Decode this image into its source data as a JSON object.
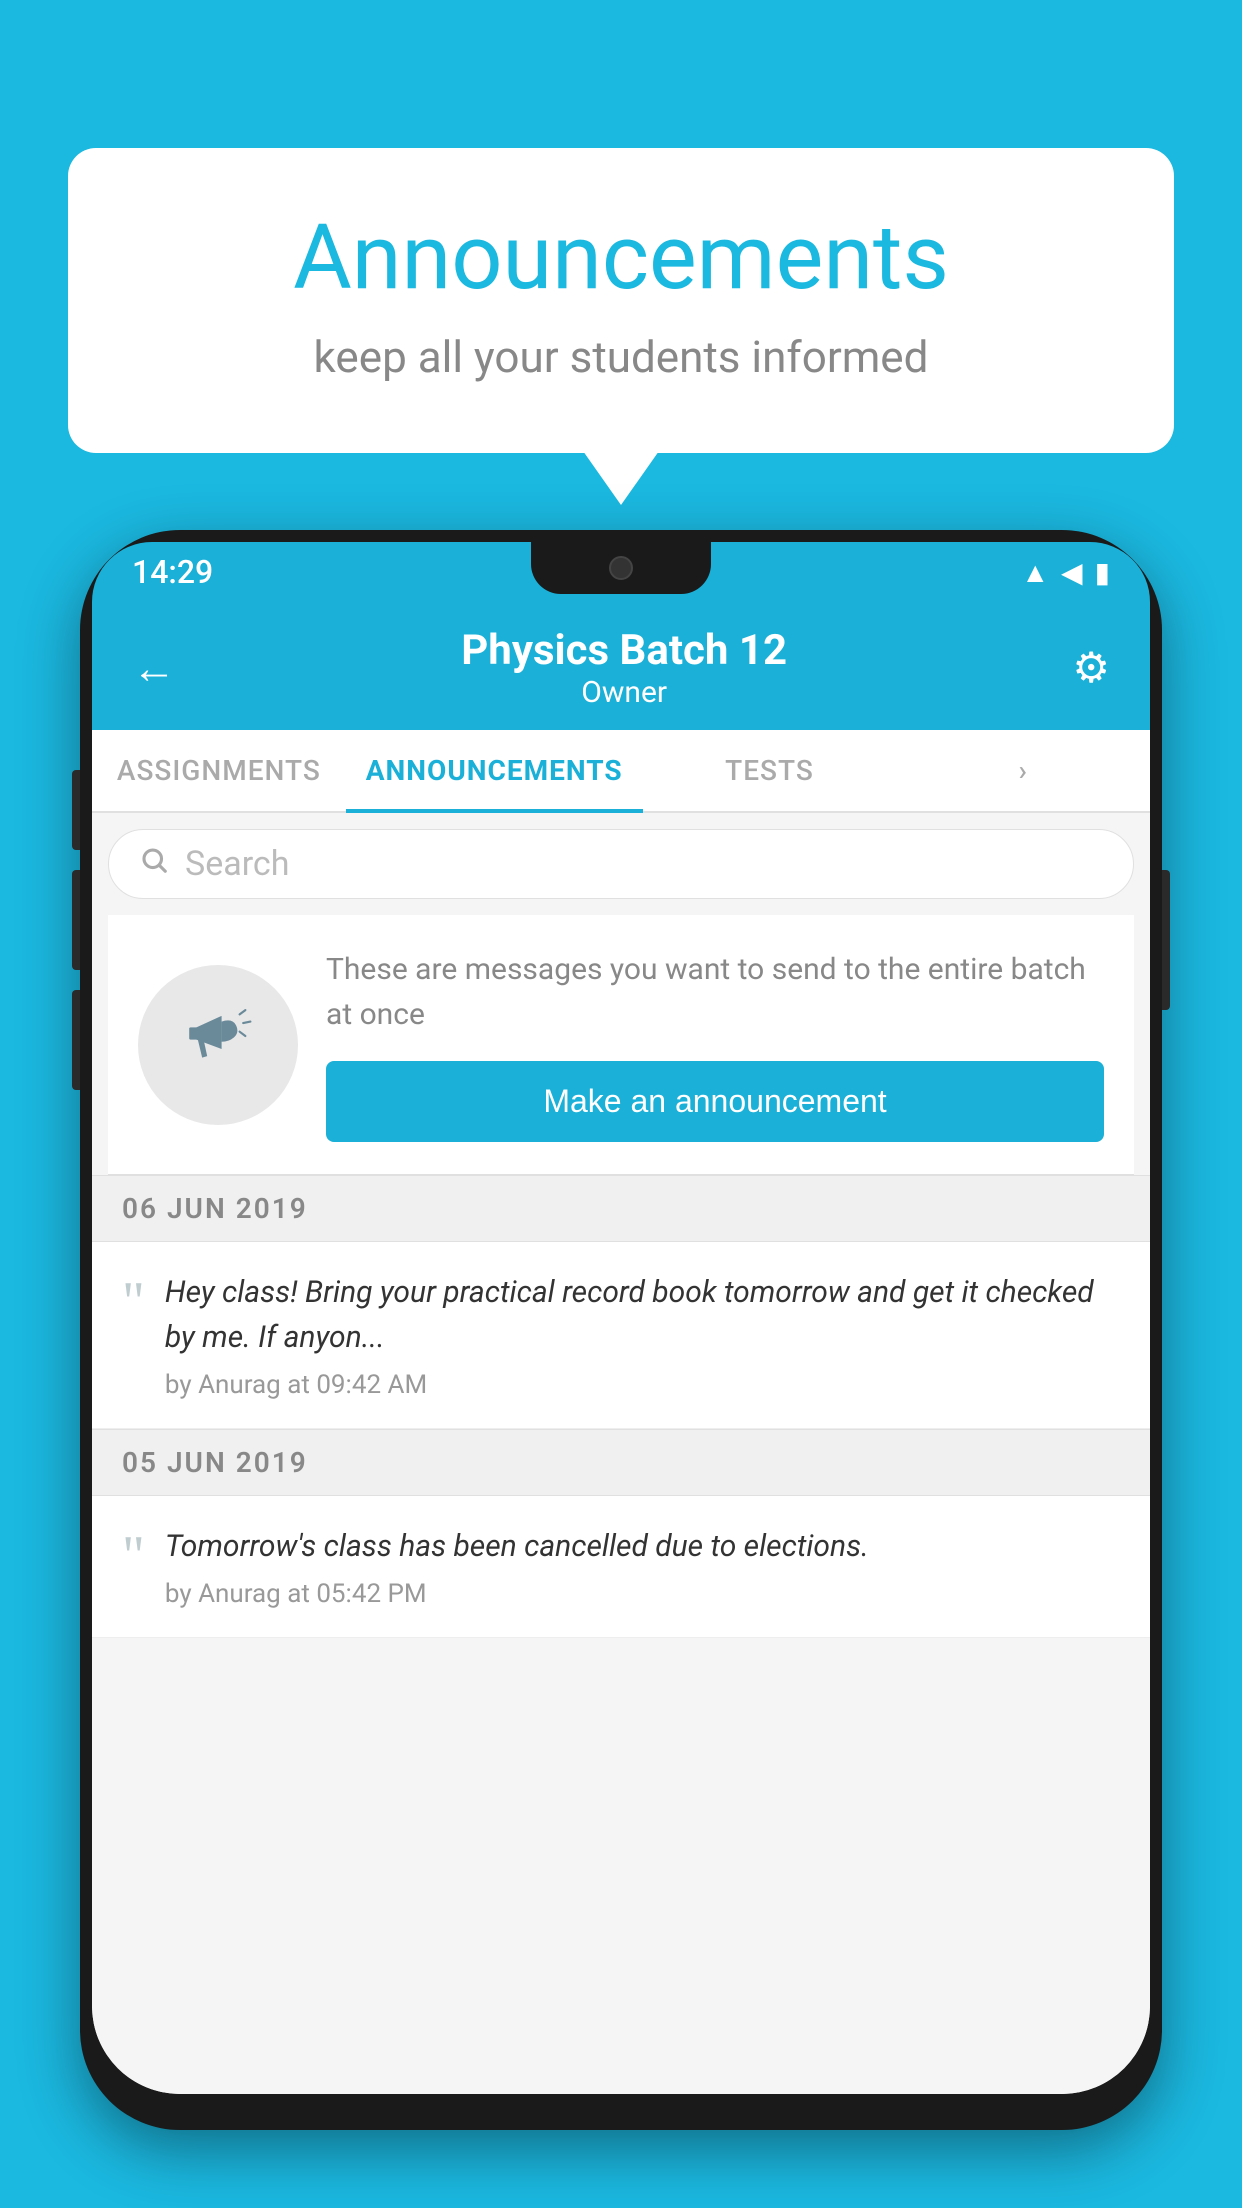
{
  "speech_bubble": {
    "title": "Announcements",
    "subtitle": "keep all your students informed"
  },
  "status_bar": {
    "time": "14:29",
    "wifi": "▲",
    "signal": "▲",
    "battery": "▮"
  },
  "header": {
    "batch_name": "Physics Batch 12",
    "role": "Owner",
    "back_label": "←",
    "gear_label": "⚙"
  },
  "tabs": [
    {
      "label": "ASSIGNMENTS",
      "active": false
    },
    {
      "label": "ANNOUNCEMENTS",
      "active": true
    },
    {
      "label": "TESTS",
      "active": false
    },
    {
      "label": "...",
      "active": false
    }
  ],
  "search": {
    "placeholder": "Search"
  },
  "promo": {
    "description": "These are messages you want to\nsend to the entire batch at once",
    "button_label": "Make an announcement"
  },
  "announcements": [
    {
      "date": "06  JUN  2019",
      "text": "Hey class! Bring your practical record book tomorrow and get it checked by me. If anyon...",
      "meta": "by Anurag at 09:42 AM"
    },
    {
      "date": "05  JUN  2019",
      "text": "Tomorrow's class has been cancelled due to elections.",
      "meta": "by Anurag at 05:42 PM"
    }
  ],
  "colors": {
    "bg": "#1bb8e0",
    "header_bg": "#1ab0d8",
    "button_bg": "#1ab0d8",
    "title_color": "#1bb8e0",
    "tab_active": "#1ab0d8"
  }
}
